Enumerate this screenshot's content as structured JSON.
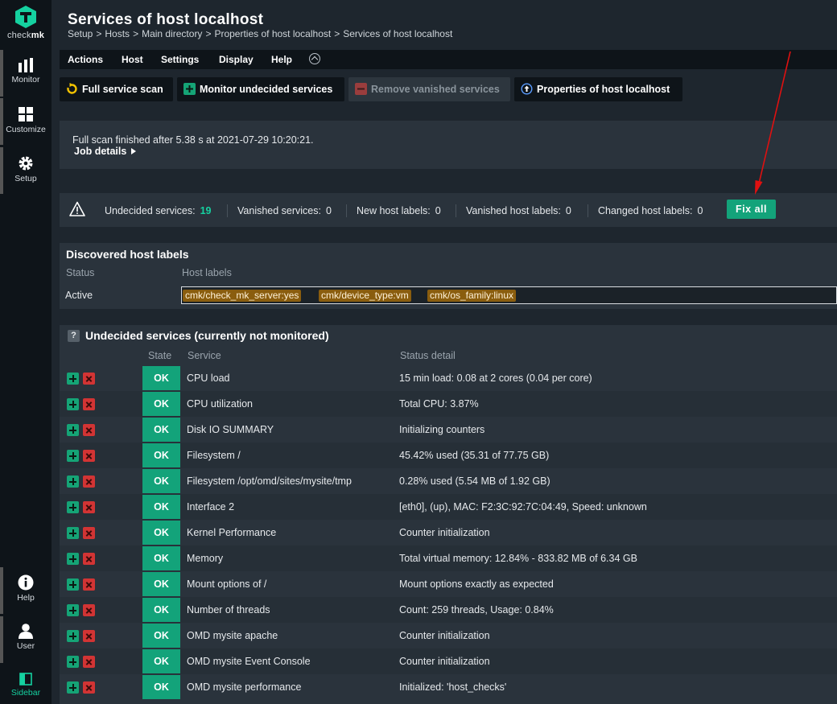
{
  "nav": {
    "brand_a": "check",
    "brand_b": "mk",
    "items": [
      {
        "label": "Monitor",
        "icon": "monitor-icon"
      },
      {
        "label": "Customize",
        "icon": "customize-icon"
      },
      {
        "label": "Setup",
        "icon": "gear-icon"
      }
    ],
    "bottom": [
      {
        "label": "Help",
        "icon": "info-icon"
      },
      {
        "label": "User",
        "icon": "user-icon"
      },
      {
        "label": "Sidebar",
        "icon": "sidebar-icon"
      }
    ]
  },
  "header": {
    "title": "Services of host localhost",
    "breadcrumb": [
      "Setup",
      "Hosts",
      "Main directory",
      "Properties of host localhost",
      "Services of host localhost"
    ]
  },
  "menubar": [
    "Actions",
    "Host",
    "Settings",
    "Display",
    "Help"
  ],
  "buttons": [
    {
      "label": "Full service scan",
      "icon": "refresh-icon"
    },
    {
      "label": "Monitor undecided services",
      "icon": "plus-icon"
    },
    {
      "label": "Remove vanished services",
      "icon": "minus-icon",
      "disabled": true
    },
    {
      "label": "Properties of host localhost",
      "icon": "up-arrow-icon"
    }
  ],
  "info": {
    "message": "Full scan finished after 5.38 s at 2021-07-29 10:20:21.",
    "job_details": "Job details"
  },
  "summary": {
    "items": [
      {
        "label": "Undecided services:",
        "value": "19"
      },
      {
        "label": "Vanished services:",
        "value": "0"
      },
      {
        "label": "New host labels:",
        "value": "0"
      },
      {
        "label": "Vanished host labels:",
        "value": "0"
      },
      {
        "label": "Changed host labels:",
        "value": "0"
      }
    ],
    "fix_all": "Fix all"
  },
  "host_labels": {
    "title": "Discovered host labels",
    "col_status": "Status",
    "col_labels": "Host labels",
    "status": "Active",
    "labels": [
      "cmk/check_mk_server:yes",
      "cmk/device_type:vm",
      "cmk/os_family:linux"
    ]
  },
  "services": {
    "title": "Undecided services (currently not monitored)",
    "columns": {
      "state": "State",
      "service": "Service",
      "detail": "Status detail"
    },
    "rows": [
      {
        "state": "OK",
        "service": "CPU load",
        "detail": "15 min load: 0.08 at 2 cores (0.04 per core)"
      },
      {
        "state": "OK",
        "service": "CPU utilization",
        "detail": "Total CPU: 3.87%"
      },
      {
        "state": "OK",
        "service": "Disk IO SUMMARY",
        "detail": "Initializing counters"
      },
      {
        "state": "OK",
        "service": "Filesystem /",
        "detail": "45.42% used (35.31 of 77.75 GB)"
      },
      {
        "state": "OK",
        "service": "Filesystem /opt/omd/sites/mysite/tmp",
        "detail": "0.28% used (5.54 MB of 1.92 GB)"
      },
      {
        "state": "OK",
        "service": "Interface 2",
        "detail": "[eth0], (up), MAC: F2:3C:92:7C:04:49, Speed: unknown"
      },
      {
        "state": "OK",
        "service": "Kernel Performance",
        "detail": "Counter initialization"
      },
      {
        "state": "OK",
        "service": "Memory",
        "detail": "Total virtual memory: 12.84% - 833.82 MB of 6.34 GB"
      },
      {
        "state": "OK",
        "service": "Mount options of /",
        "detail": "Mount options exactly as expected"
      },
      {
        "state": "OK",
        "service": "Number of threads",
        "detail": "Count: 259 threads, Usage: 0.84%"
      },
      {
        "state": "OK",
        "service": "OMD mysite apache",
        "detail": "Counter initialization"
      },
      {
        "state": "OK",
        "service": "OMD mysite Event Console",
        "detail": "Counter initialization"
      },
      {
        "state": "OK",
        "service": "OMD mysite performance",
        "detail": "Initialized: 'host_checks'"
      }
    ]
  },
  "colors": {
    "accent": "#13a37a",
    "danger": "#d23434",
    "label_tag": "#8a5d0e",
    "annotation_arrow": "#e01010"
  }
}
